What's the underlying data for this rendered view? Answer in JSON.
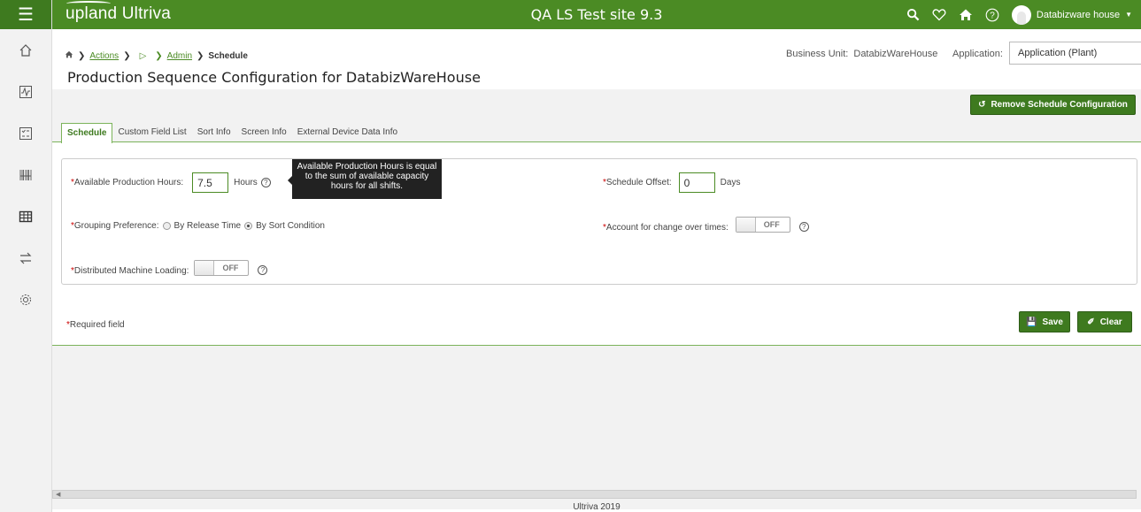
{
  "app": {
    "logo": "upland Ultriva",
    "site_title": "QA LS Test site 9.3",
    "user_name": "Databizware house",
    "accent_color": "#4b8b24"
  },
  "top_icons": [
    "search-icon",
    "heart-icon",
    "home-icon",
    "help-icon"
  ],
  "sidebar": {
    "items": [
      "home-icon",
      "activity-icon",
      "checklist-icon",
      "barcode-icon",
      "grid-icon",
      "transfer-icon",
      "settings-icon"
    ]
  },
  "breadcrumb": {
    "actions": "Actions",
    "step1": "",
    "step2": "",
    "admin": "Admin",
    "current": "Schedule"
  },
  "page": {
    "title": "Production Sequence Configuration for DatabizWareHouse"
  },
  "business_unit": {
    "label": "Business Unit:",
    "value": "DatabizWareHouse"
  },
  "application": {
    "label": "Application:",
    "selected": "Application (Plant)"
  },
  "buttons": {
    "remove_schedule": "Remove Schedule Configuration",
    "save": "Save",
    "clear": "Clear"
  },
  "tabs": [
    "Schedule",
    "Custom Field List",
    "Sort Info",
    "Screen Info",
    "External Device Data Info"
  ],
  "form": {
    "available_hours": {
      "label": "Available Production Hours:",
      "value": "7.5",
      "unit": "Hours"
    },
    "tooltip": "Available Production Hours is equal to the sum of available capacity hours for all shifts.",
    "schedule_offset": {
      "label": "Schedule Offset:",
      "value": "0",
      "unit": "Days"
    },
    "grouping": {
      "label": "Grouping Preference:",
      "option1": "By Release Time",
      "option2": "By Sort Condition",
      "selected": "By Sort Condition"
    },
    "changeover": {
      "label": "Account for change over times:",
      "state": "OFF"
    },
    "distributed": {
      "label": "Distributed Machine Loading:",
      "state": "OFF"
    },
    "required_mark": "*",
    "required_note": "Required field"
  },
  "footer": {
    "copyright": "Ultriva 2019"
  }
}
